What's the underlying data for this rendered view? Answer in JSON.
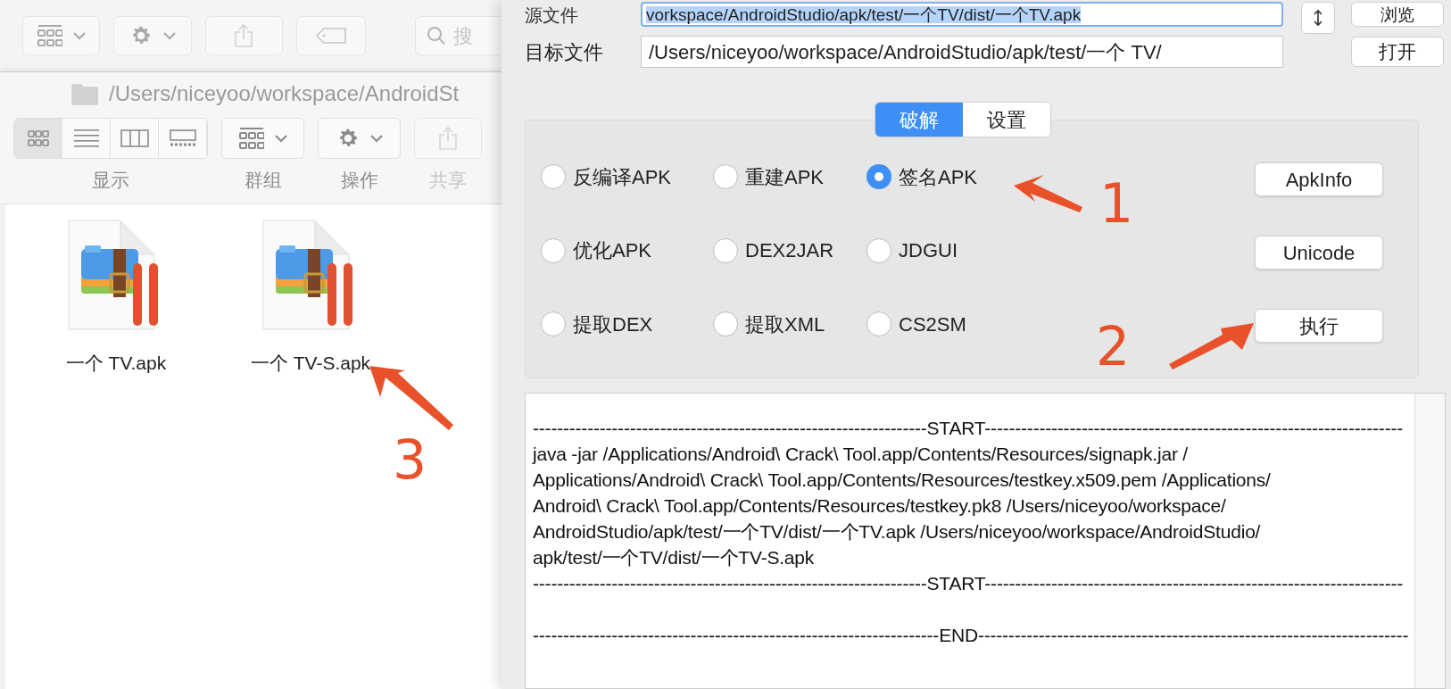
{
  "background_finder": {
    "toolbar": [
      {
        "kind": "group"
      },
      {
        "kind": "action"
      },
      {
        "kind": "share"
      },
      {
        "kind": "tag"
      }
    ],
    "search": {
      "placeholder": "搜"
    }
  },
  "finder": {
    "path": "/Users/niceyoo/workspace/AndroidSt",
    "view_modes": [
      {
        "kind": "icons",
        "selected": true
      },
      {
        "kind": "list",
        "selected": false
      },
      {
        "kind": "columns",
        "selected": false
      },
      {
        "kind": "gallery",
        "selected": false
      }
    ],
    "view_label": "显示",
    "toolbar": [
      {
        "kind": "group",
        "label": "群组",
        "disabled": false
      },
      {
        "kind": "action",
        "label": "操作",
        "disabled": false
      },
      {
        "kind": "share",
        "label": "共享",
        "disabled": true
      }
    ],
    "files": [
      {
        "name": "一个 TV.apk"
      },
      {
        "name": "一个 TV-S.apk"
      }
    ]
  },
  "app": {
    "source": {
      "label": "源文件",
      "value": "vorkspace/AndroidStudio/apk/test/一个TV/dist/一个TV.apk",
      "button": "浏览"
    },
    "target": {
      "label": "目标文件",
      "value": "/Users/niceyoo/workspace/AndroidStudio/apk/test/一个 TV/",
      "button": "打开"
    },
    "tabs": [
      {
        "label": "破解",
        "selected": true
      },
      {
        "label": "设置",
        "selected": false
      }
    ],
    "options": [
      {
        "label": "反编译APK",
        "selected": false
      },
      {
        "label": "重建APK",
        "selected": false
      },
      {
        "label": "签名APK",
        "selected": true
      },
      {
        "label": "优化APK",
        "selected": false
      },
      {
        "label": "DEX2JAR",
        "selected": false
      },
      {
        "label": "JDGUI",
        "selected": false
      },
      {
        "label": "提取DEX",
        "selected": false
      },
      {
        "label": "提取XML",
        "selected": false
      },
      {
        "label": "CS2SM",
        "selected": false
      }
    ],
    "buttons": [
      "ApkInfo",
      "Unicode",
      "执行"
    ],
    "log": [
      "-----------------------------------------------------------------START---------------------------------------------------------------------",
      "java -jar /Applications/Android\\ Crack\\ Tool.app/Contents/Resources/signapk.jar  /",
      "Applications/Android\\ Crack\\ Tool.app/Contents/Resources/testkey.x509.pem  /Applications/",
      "Android\\ Crack\\ Tool.app/Contents/Resources/testkey.pk8   /Users/niceyoo/workspace/",
      "AndroidStudio/apk/test/一个TV/dist/一个TV.apk  /Users/niceyoo/workspace/AndroidStudio/",
      "apk/test/一个TV/dist/一个TV-S.apk",
      "-----------------------------------------------------------------START---------------------------------------------------------------------",
      "-------------------------------------------------------------------END-----------------------------------------------------------------------"
    ]
  },
  "annotations": [
    {
      "text": "1"
    },
    {
      "text": "2"
    },
    {
      "text": "3"
    }
  ]
}
